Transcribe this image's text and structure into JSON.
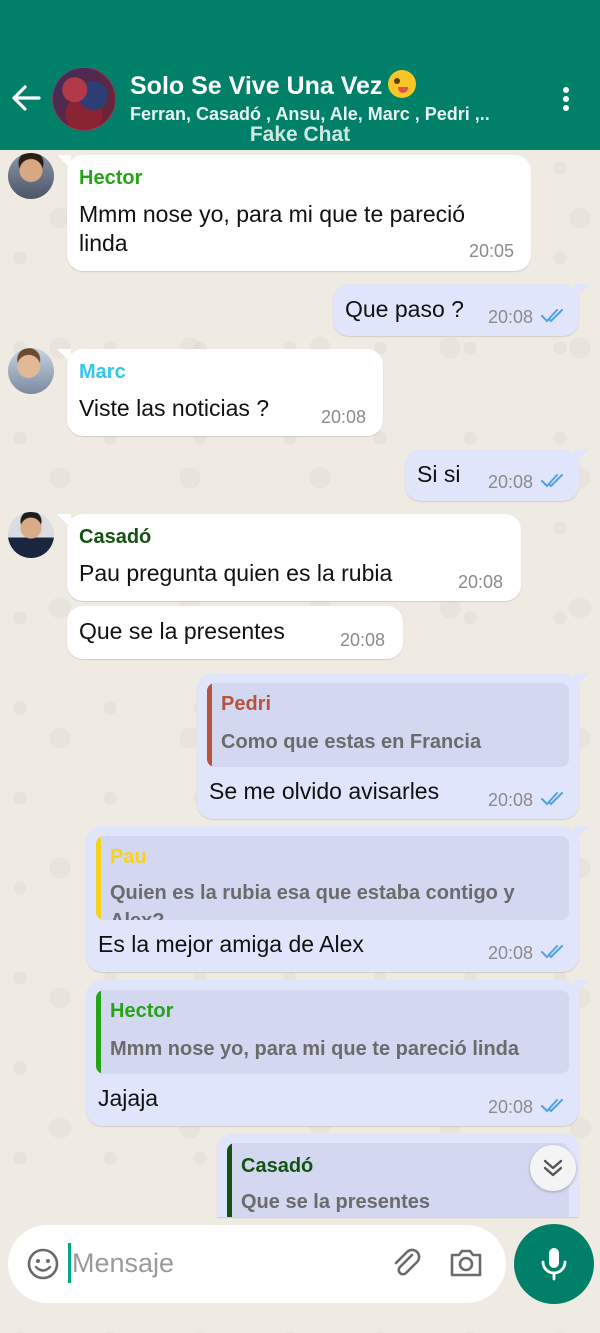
{
  "header": {
    "title": "Solo Se Vive Una Vez",
    "title_emoji": "zany-face-emoji",
    "members": "Ferran, Casadó , Ansu, Ale, Marc , Pedri ,..",
    "watermark": "Fake Chat",
    "background_color": "#008069"
  },
  "messages": [
    {
      "sender": "Hector",
      "sender_color": "#25a515",
      "text_line1": "Mmm nose yo, para mi que te pareció",
      "text_line2": "linda",
      "time": "20:05",
      "direction": "incoming"
    },
    {
      "text": "Que paso ?",
      "time": "20:08",
      "direction": "outgoing",
      "status": "read"
    },
    {
      "sender": "Marc",
      "sender_color": "#35c7e8",
      "text": "Viste las noticias ?",
      "time": "20:08",
      "direction": "incoming"
    },
    {
      "text": "Si si",
      "time": "20:08",
      "direction": "outgoing",
      "status": "read"
    },
    {
      "sender": "Casadó",
      "sender_color": "#145214",
      "text": "Pau pregunta quien es la rubia",
      "time": "20:08",
      "direction": "incoming"
    },
    {
      "text": "Que se la presentes",
      "time": "20:08",
      "direction": "incoming"
    },
    {
      "quote_author": "Pedri",
      "quote_color": "#b5533c",
      "quote_text": "Como que estas en Francia",
      "text": "Se me olvido avisarles",
      "time": "20:08",
      "direction": "outgoing",
      "status": "read"
    },
    {
      "quote_author": "Pau",
      "quote_color": "#f5d21e",
      "quote_text": "Quien es la rubia esa que estaba contigo y Alex?",
      "text": "Es la mejor amiga de Alex",
      "time": "20:08",
      "direction": "outgoing",
      "status": "read"
    },
    {
      "quote_author": "Hector",
      "quote_color": "#25a515",
      "quote_text": "Mmm nose yo, para mi que te pareció linda",
      "text": "Jajaja",
      "time": "20:08",
      "direction": "outgoing",
      "status": "read"
    },
    {
      "quote_author": "Casadó",
      "quote_color": "#145214",
      "quote_text": "Que se la presentes",
      "direction": "outgoing"
    }
  ],
  "input": {
    "placeholder": "Mensaje"
  },
  "colors": {
    "accent": "#008069",
    "read_ticks": "#4fa3e0",
    "outgoing_bubble": "#e0e5fb"
  }
}
